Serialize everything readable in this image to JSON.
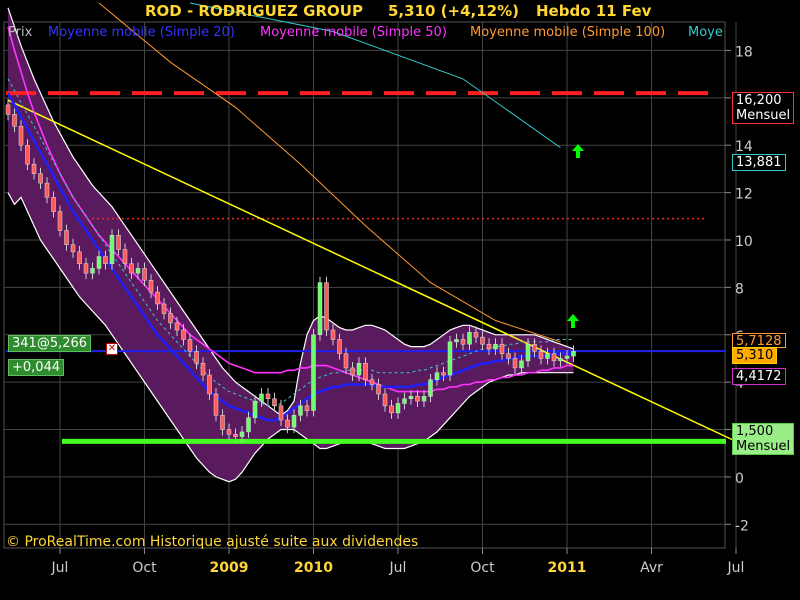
{
  "header": {
    "ticker": "ROD - RODRIGUEZ GROUP",
    "quote": "5,310 (+4,12%)",
    "period": "Hebdo  11 Fev"
  },
  "legend": [
    {
      "label": "Prix",
      "color": "#bbbbbb"
    },
    {
      "label": "Moyenne mobile (Simple 20)",
      "color": "#3333ff"
    },
    {
      "label": "Moyenne mobile (Simple 50)",
      "color": "#ff33ff"
    },
    {
      "label": "Moyenne mobile (Simple 100)",
      "color": "#ff9933"
    },
    {
      "label": "Moye",
      "color": "#33cccc"
    }
  ],
  "footer": "© ProRealTime.com Historique ajusté suite aux dividendes",
  "tags": {
    "resistance_price": "16,200",
    "resistance_note": "Mensuel",
    "ma100_value": "13,881",
    "overlap_value": "5,7128",
    "last_price": "5,310",
    "lower_band": "4,4172",
    "support_price": "1,500",
    "support_note": "Mensuel",
    "order_label": "341@5,266",
    "order_delta": "+0,044"
  },
  "chart_data": {
    "type": "candlestick",
    "title": "ROD - RODRIGUEZ GROUP",
    "ylim": [
      -3,
      19.2
    ],
    "y_ticks": [
      -2,
      0,
      2,
      4,
      6,
      8,
      10,
      12,
      14,
      16,
      18
    ],
    "y_tick_labels": [
      "-2",
      "0",
      "2",
      "4",
      "6",
      "8",
      "10",
      "12",
      "14",
      "16",
      "18"
    ],
    "x_ticks": [
      {
        "label": "Jul",
        "bold": false
      },
      {
        "label": "Oct",
        "bold": false
      },
      {
        "label": "2009",
        "bold": true
      },
      {
        "label": "2010",
        "bold": true
      },
      {
        "label": "Jul",
        "bold": false
      },
      {
        "label": "Oct",
        "bold": false
      },
      {
        "label": "2011",
        "bold": true
      },
      {
        "label": "Avr",
        "bold": false
      },
      {
        "label": "Jul",
        "bold": false
      }
    ],
    "x_tick_index": [
      8,
      21,
      34,
      47,
      60,
      73,
      86,
      99,
      112
    ],
    "close": [
      15.3,
      14.8,
      14.0,
      13.2,
      12.8,
      12.4,
      11.8,
      11.2,
      10.4,
      9.8,
      9.5,
      9.0,
      8.6,
      8.8,
      9.3,
      9.0,
      10.2,
      9.6,
      9.0,
      8.6,
      8.8,
      8.3,
      7.8,
      7.3,
      6.9,
      6.5,
      6.2,
      5.8,
      5.3,
      4.8,
      4.3,
      3.5,
      2.6,
      2.0,
      1.8,
      1.7,
      1.9,
      2.5,
      3.2,
      3.5,
      3.3,
      3.0,
      2.4,
      2.1,
      2.6,
      3.0,
      2.8,
      6.0,
      8.2,
      6.2,
      5.8,
      5.2,
      4.6,
      4.3,
      4.8,
      4.1,
      3.9,
      3.5,
      3.0,
      2.7,
      3.1,
      3.3,
      3.4,
      3.2,
      3.4,
      4.1,
      4.4,
      4.3,
      5.7,
      5.8,
      5.6,
      6.1,
      5.9,
      5.6,
      5.4,
      5.6,
      5.2,
      5.0,
      4.6,
      4.9,
      5.6,
      5.3,
      5.0,
      5.2,
      4.9,
      5.0,
      5.1,
      5.3
    ],
    "ma20": [
      16.2,
      15.7,
      15.2,
      14.7,
      14.2,
      13.7,
      13.2,
      12.7,
      12.2,
      11.7,
      11.2,
      10.8,
      10.4,
      10.0,
      9.6,
      9.2,
      8.8,
      8.4,
      8.0,
      7.6,
      7.2,
      6.8,
      6.4,
      6.0,
      5.7,
      5.4,
      5.1,
      4.8,
      4.5,
      4.2,
      3.9,
      3.6,
      3.4,
      3.2,
      3.0,
      2.9,
      2.8,
      2.7,
      2.6,
      2.5,
      2.4,
      2.4,
      2.5,
      2.7,
      2.9,
      3.1,
      3.3,
      3.5,
      3.6,
      3.7,
      3.8,
      3.8,
      3.9,
      3.9,
      3.9,
      3.9,
      3.9,
      3.8,
      3.8,
      3.8,
      3.8,
      3.8,
      3.8,
      3.9,
      3.9,
      4.0,
      4.1,
      4.2,
      4.3,
      4.4,
      4.5,
      4.6,
      4.7,
      4.8,
      4.8,
      4.9,
      4.9,
      5.0,
      5.0,
      5.1,
      5.1,
      5.1,
      5.1,
      5.1,
      5.2,
      5.2,
      5.2,
      5.2
    ],
    "ma50": [
      19.0,
      18.0,
      17.1,
      16.2,
      15.4,
      14.7,
      14.0,
      13.4,
      12.8,
      12.3,
      11.8,
      11.4,
      11.0,
      10.6,
      10.2,
      9.9,
      9.6,
      9.3,
      9.0,
      8.7,
      8.4,
      8.1,
      7.8,
      7.5,
      7.2,
      6.9,
      6.6,
      6.3,
      6.0,
      5.8,
      5.6,
      5.4,
      5.2,
      5.0,
      4.8,
      4.7,
      4.6,
      4.5,
      4.4,
      4.4,
      4.4,
      4.4,
      4.4,
      4.5,
      4.5,
      4.6,
      4.6,
      4.7,
      4.7,
      4.7,
      4.6,
      4.5,
      4.4,
      4.3,
      4.2,
      4.1,
      4.0,
      3.9,
      3.8,
      3.7,
      3.6,
      3.6,
      3.6,
      3.6,
      3.6,
      3.6,
      3.7,
      3.7,
      3.8,
      3.8,
      3.9,
      3.9,
      4.0,
      4.0,
      4.1,
      4.1,
      4.2,
      4.2,
      4.3,
      4.3,
      4.4,
      4.4,
      4.5,
      4.5,
      4.6,
      4.6,
      4.7,
      4.7
    ],
    "ma100_x": [
      14,
      25,
      35,
      45,
      55,
      65,
      75,
      85
    ],
    "ma100": [
      20.0,
      17.5,
      15.6,
      13.2,
      10.6,
      8.2,
      6.6,
      5.7
    ],
    "ma200_x": [
      28,
      50,
      70,
      85
    ],
    "ma200": [
      20.0,
      18.8,
      16.8,
      13.9
    ],
    "bollinger_upper": [
      19.8,
      19.0,
      18.2,
      17.5,
      16.8,
      16.2,
      15.6,
      15.0,
      14.5,
      14.0,
      13.5,
      13.1,
      12.7,
      12.3,
      12.0,
      11.7,
      11.4,
      11.0,
      10.6,
      10.2,
      9.8,
      9.4,
      9.0,
      8.6,
      8.2,
      7.8,
      7.4,
      7.0,
      6.6,
      6.2,
      5.8,
      5.4,
      5.0,
      4.6,
      4.3,
      4.0,
      3.8,
      3.6,
      3.4,
      3.2,
      3.0,
      2.8,
      2.6,
      2.8,
      3.2,
      4.8,
      6.0,
      6.6,
      6.8,
      6.7,
      6.5,
      6.3,
      6.2,
      6.2,
      6.3,
      6.4,
      6.4,
      6.3,
      6.2,
      6.0,
      5.8,
      5.6,
      5.5,
      5.5,
      5.5,
      5.6,
      5.8,
      6.0,
      6.2,
      6.3,
      6.4,
      6.4,
      6.3,
      6.2,
      6.1,
      6.0,
      6.0,
      6.0,
      6.0,
      6.0,
      6.0,
      6.0,
      5.9,
      5.8,
      5.7,
      5.6,
      5.5,
      5.4
    ],
    "bollinger_lower": [
      12.0,
      11.5,
      11.8,
      11.2,
      10.6,
      10.0,
      9.6,
      9.2,
      8.8,
      8.4,
      8.0,
      7.6,
      7.3,
      7.0,
      6.7,
      6.4,
      6.0,
      5.6,
      5.2,
      4.8,
      4.4,
      4.0,
      3.6,
      3.2,
      2.8,
      2.4,
      2.0,
      1.6,
      1.2,
      0.8,
      0.5,
      0.2,
      0.0,
      -0.1,
      -0.2,
      -0.1,
      0.2,
      0.6,
      1.0,
      1.3,
      1.6,
      1.8,
      2.0,
      2.0,
      2.0,
      1.8,
      1.6,
      1.4,
      1.2,
      1.2,
      1.3,
      1.4,
      1.5,
      1.5,
      1.5,
      1.5,
      1.4,
      1.3,
      1.2,
      1.2,
      1.2,
      1.2,
      1.3,
      1.4,
      1.5,
      1.7,
      1.9,
      2.2,
      2.5,
      2.8,
      3.1,
      3.4,
      3.6,
      3.8,
      4.0,
      4.1,
      4.2,
      4.3,
      4.3,
      4.4,
      4.4,
      4.4,
      4.4,
      4.4,
      4.4,
      4.4,
      4.4,
      4.4
    ],
    "resistance_level": 16.2,
    "support_level": 1.5,
    "dotted_level": 10.9,
    "last_price": 5.31,
    "trendline": {
      "from": [
        0,
        15.9
      ],
      "to": [
        112,
        1.5
      ]
    }
  }
}
